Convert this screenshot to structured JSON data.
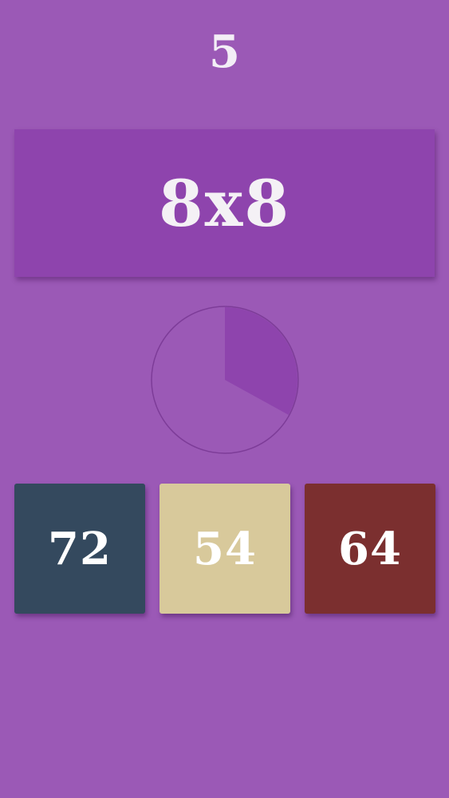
{
  "score": "5",
  "question": "8x8",
  "timer": {
    "remaining_fraction": 0.33,
    "colors": {
      "face": "#9b59b6",
      "elapsed": "#8e44ad",
      "rim": "#7d3c98"
    }
  },
  "answers": [
    {
      "label": "72",
      "color": "#34495e"
    },
    {
      "label": "54",
      "color": "#d8c99b"
    },
    {
      "label": "64",
      "color": "#7b2f2f"
    }
  ],
  "theme": {
    "background": "#9b59b6",
    "question_box": "#8e44ad",
    "text": "#f4f1f5"
  }
}
